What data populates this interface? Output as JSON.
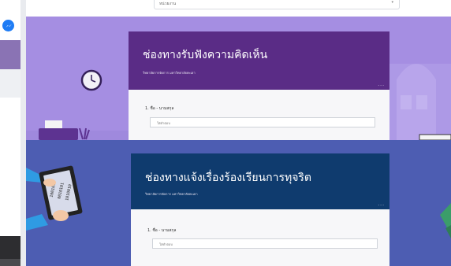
{
  "sidebar": {
    "messenger_icon": "messenger-icon"
  },
  "top_dropdown": {
    "value": "หน่วยงาน",
    "caret": "▾"
  },
  "forms": [
    {
      "title": "ช่องทางรับฟังความคิดเห็น",
      "subtitle": "วิทยาลัยการจัดการ มหาวิทยาลัยพะเยา",
      "more": "...",
      "field_label": "1. ชื่อ - นามสกุล",
      "field_placeholder": "ใส่คำตอบ",
      "header_color": "#5a2c86",
      "background_color": "#a58ee2"
    },
    {
      "title": "ช่องทางแจ้งเรื่องร้องเรียนการทุจริต",
      "subtitle": "วิทยาลัยการจัดการ มหาวิทยาลัยพะเยา",
      "more": "...",
      "field_label": "1. ชื่อ - นามสกุล",
      "field_placeholder": "ใส่คำตอบ",
      "header_color": "#0f3b6e",
      "background_color": "#4d5db2"
    }
  ],
  "tablet_text": {
    "line1": "1001010",
    "line2": "0010101",
    "line3": "1010010"
  }
}
